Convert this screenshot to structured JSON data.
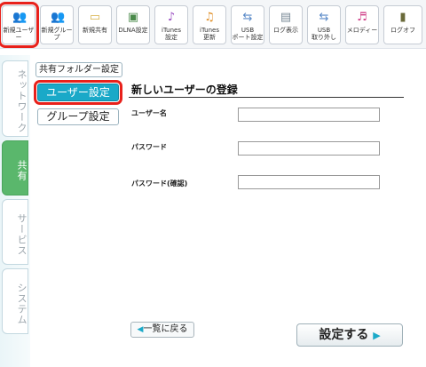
{
  "toolbar": {
    "items": [
      {
        "label": "新規ユーザー",
        "icon": "users-icon"
      },
      {
        "label": "新規グループ",
        "icon": "group-icon"
      },
      {
        "label": "新規共有",
        "icon": "folder-icon"
      },
      {
        "label": "DLNA設定",
        "icon": "dlna-icon"
      },
      {
        "label": "iTunes\n設定",
        "icon": "music-note-icon"
      },
      {
        "label": "iTunes\n更新",
        "icon": "itunes-refresh-icon"
      },
      {
        "label": "USB\nポート設定",
        "icon": "usb-icon"
      },
      {
        "label": "ログ表示",
        "icon": "log-icon"
      },
      {
        "label": "USB\n取り外し",
        "icon": "usb-remove-icon"
      },
      {
        "label": "メロディー",
        "icon": "melody-icon"
      },
      {
        "label": "ログオフ",
        "icon": "logoff-icon"
      }
    ]
  },
  "side_tabs": [
    {
      "label": "ネットワーク"
    },
    {
      "label": "共有"
    },
    {
      "label": "サービス"
    },
    {
      "label": "システム"
    }
  ],
  "sub_nav": {
    "items": [
      {
        "label": "共有フォルダー設定"
      },
      {
        "label": "ユーザー設定"
      },
      {
        "label": "グループ設定"
      }
    ]
  },
  "main": {
    "title": "新しいユーザーの登録",
    "fields": [
      {
        "label": "ユーザー名",
        "value": ""
      },
      {
        "label": "パスワード",
        "value": ""
      },
      {
        "label": "パスワード(確認)",
        "value": ""
      }
    ]
  },
  "footer": {
    "back_label": "一覧に戻る",
    "submit_label": "設定する"
  },
  "colors": {
    "accent": "#1aa9c8",
    "highlight": "#e8211b",
    "tab_active": "#5ab76c"
  }
}
